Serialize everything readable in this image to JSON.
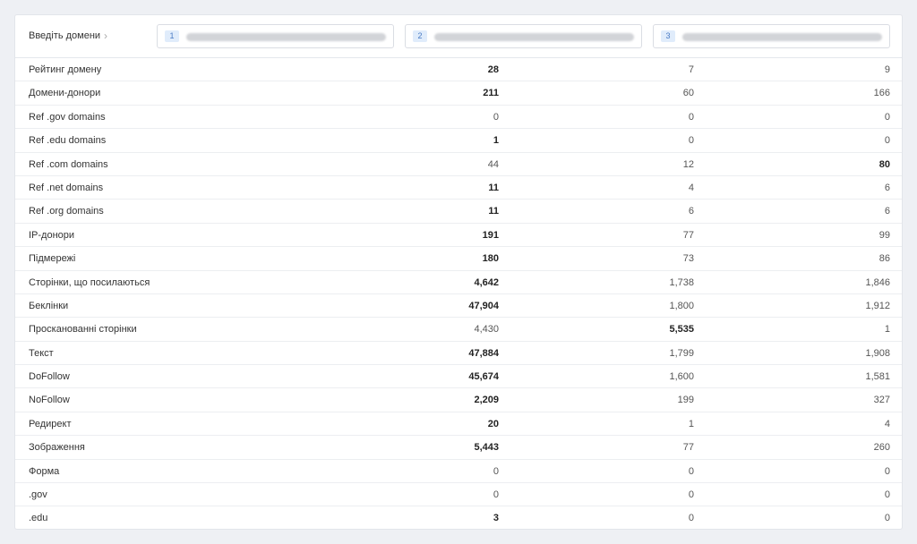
{
  "header": {
    "label": "Введіть домени",
    "chevron": "›",
    "inputs": [
      {
        "num": "1"
      },
      {
        "num": "2"
      },
      {
        "num": "3"
      }
    ]
  },
  "rows": [
    {
      "label": "Рейтинг домену",
      "v1": "28",
      "v2": "7",
      "v3": "9",
      "best": 1
    },
    {
      "label": "Домени-донори",
      "v1": "211",
      "v2": "60",
      "v3": "166",
      "best": 1
    },
    {
      "label": "Ref .gov domains",
      "v1": "0",
      "v2": "0",
      "v3": "0",
      "best": 0
    },
    {
      "label": "Ref .edu domains",
      "v1": "1",
      "v2": "0",
      "v3": "0",
      "best": 1
    },
    {
      "label": "Ref .com domains",
      "v1": "44",
      "v2": "12",
      "v3": "80",
      "best": 3
    },
    {
      "label": "Ref .net domains",
      "v1": "11",
      "v2": "4",
      "v3": "6",
      "best": 1
    },
    {
      "label": "Ref .org domains",
      "v1": "11",
      "v2": "6",
      "v3": "6",
      "best": 1
    },
    {
      "label": "IP-донори",
      "v1": "191",
      "v2": "77",
      "v3": "99",
      "best": 1
    },
    {
      "label": "Підмережі",
      "v1": "180",
      "v2": "73",
      "v3": "86",
      "best": 1
    },
    {
      "label": "Сторінки, що посилаються",
      "v1": "4,642",
      "v2": "1,738",
      "v3": "1,846",
      "best": 1
    },
    {
      "label": "Беклінки",
      "v1": "47,904",
      "v2": "1,800",
      "v3": "1,912",
      "best": 1
    },
    {
      "label": "Просканованні сторінки",
      "v1": "4,430",
      "v2": "5,535",
      "v3": "1",
      "best": 2
    },
    {
      "label": "Текст",
      "v1": "47,884",
      "v2": "1,799",
      "v3": "1,908",
      "best": 1
    },
    {
      "label": "DoFollow",
      "v1": "45,674",
      "v2": "1,600",
      "v3": "1,581",
      "best": 1
    },
    {
      "label": "NoFollow",
      "v1": "2,209",
      "v2": "199",
      "v3": "327",
      "best": 1
    },
    {
      "label": "Редирект",
      "v1": "20",
      "v2": "1",
      "v3": "4",
      "best": 1
    },
    {
      "label": "Зображення",
      "v1": "5,443",
      "v2": "77",
      "v3": "260",
      "best": 1
    },
    {
      "label": "Форма",
      "v1": "0",
      "v2": "0",
      "v3": "0",
      "best": 0
    },
    {
      "label": ".gov",
      "v1": "0",
      "v2": "0",
      "v3": "0",
      "best": 0
    },
    {
      "label": ".edu",
      "v1": "3",
      "v2": "0",
      "v3": "0",
      "best": 1
    }
  ]
}
